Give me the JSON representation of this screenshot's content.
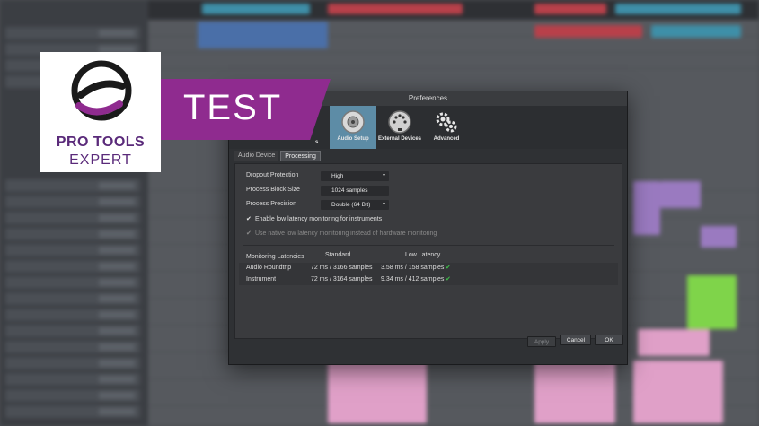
{
  "logo": {
    "line1": "PRO TOOLS",
    "line2": "EXPERT"
  },
  "banner": {
    "text": "TEST"
  },
  "dialog": {
    "title": "Preferences",
    "toolbar": {
      "partial_label": "s",
      "items": [
        {
          "label": "Audio Setup",
          "icon": "speaker-icon",
          "active": true
        },
        {
          "label": "External Devices",
          "icon": "midi-connector-icon",
          "active": false
        },
        {
          "label": "Advanced",
          "icon": "gears-icon",
          "active": false
        }
      ]
    },
    "tabs": [
      {
        "label": "Audio Device",
        "active": false
      },
      {
        "label": "Processing",
        "active": true
      }
    ],
    "settings": {
      "dropout_label": "Dropout Protection",
      "dropout_value": "High",
      "block_label": "Process Block Size",
      "block_value": "1024 samples",
      "precision_label": "Process Precision",
      "precision_value": "Double (64 Bit)",
      "low_latency_label": "Enable low latency monitoring for instruments",
      "native_label": "Use native low latency monitoring instead of hardware monitoring"
    },
    "latencies": {
      "header": "Monitoring Latencies",
      "col_standard": "Standard",
      "col_low": "Low Latency",
      "rows": [
        {
          "name": "Audio Roundtrip",
          "standard": "72 ms / 3166 samples",
          "low": "3.58 ms / 158 samples"
        },
        {
          "name": "Instrument",
          "standard": "72 ms / 3164 samples",
          "low": "9.34 ms / 412 samples"
        }
      ]
    },
    "buttons": {
      "apply": "Apply",
      "cancel": "Cancel",
      "ok": "OK"
    }
  },
  "colors": {
    "banner_purple": "#8f2b8f",
    "logo_purple": "#5a2a7a",
    "active_tool": "#5d8ca6",
    "check_green": "#3fbf4a"
  }
}
